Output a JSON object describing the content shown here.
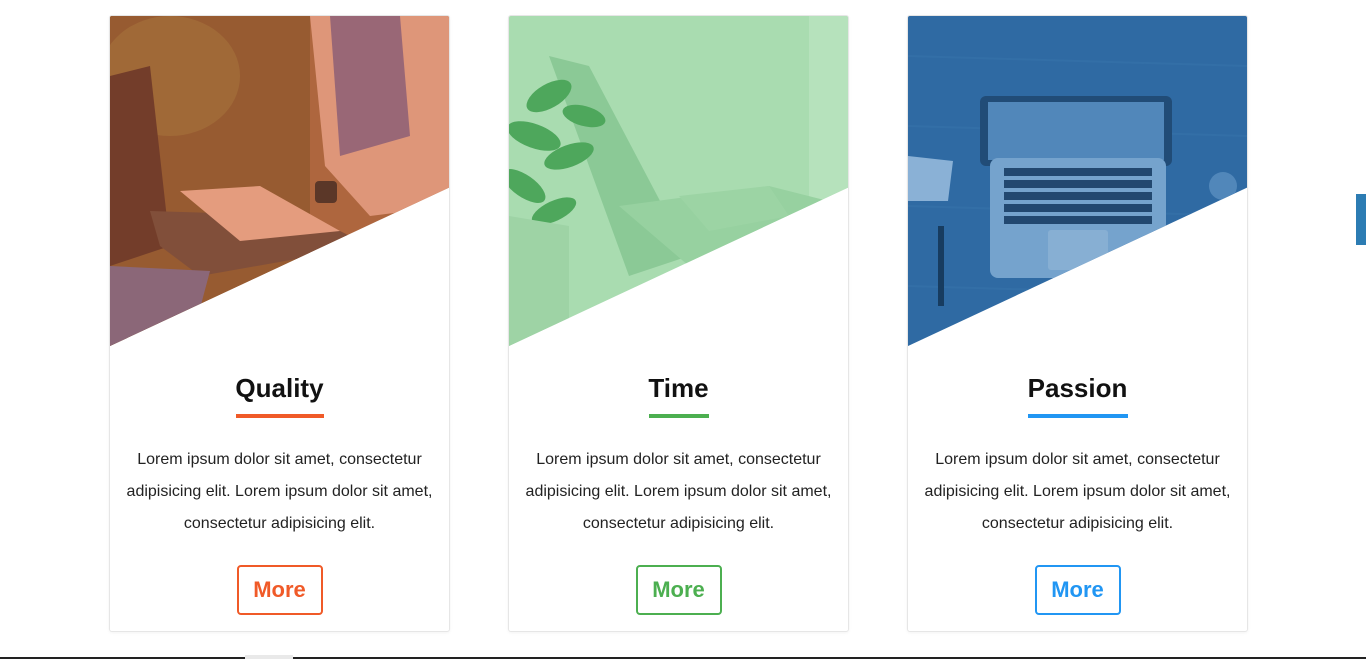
{
  "cards": [
    {
      "title": "Quality",
      "description": "Lorem ipsum dolor sit amet, consectetur adipisicing elit. Lorem ipsum dolor sit amet, consectetur adipisicing elit.",
      "button_label": "More",
      "accent_color": "#f05a28",
      "image_tint": "#c0603a",
      "image_icon": "laptop-typing-photo"
    },
    {
      "title": "Time",
      "description": "Lorem ipsum dolor sit amet, consectetur adipisicing elit. Lorem ipsum dolor sit amet, consectetur adipisicing elit.",
      "button_label": "More",
      "accent_color": "#4caf50",
      "image_tint": "#7fce8a",
      "image_icon": "plant-laptop-photo"
    },
    {
      "title": "Passion",
      "description": "Lorem ipsum dolor sit amet, consectetur adipisicing elit. Lorem ipsum dolor sit amet, consectetur adipisicing elit.",
      "button_label": "More",
      "accent_color": "#2196f3",
      "image_tint": "#2f72ad",
      "image_icon": "desk-laptop-photo"
    }
  ]
}
